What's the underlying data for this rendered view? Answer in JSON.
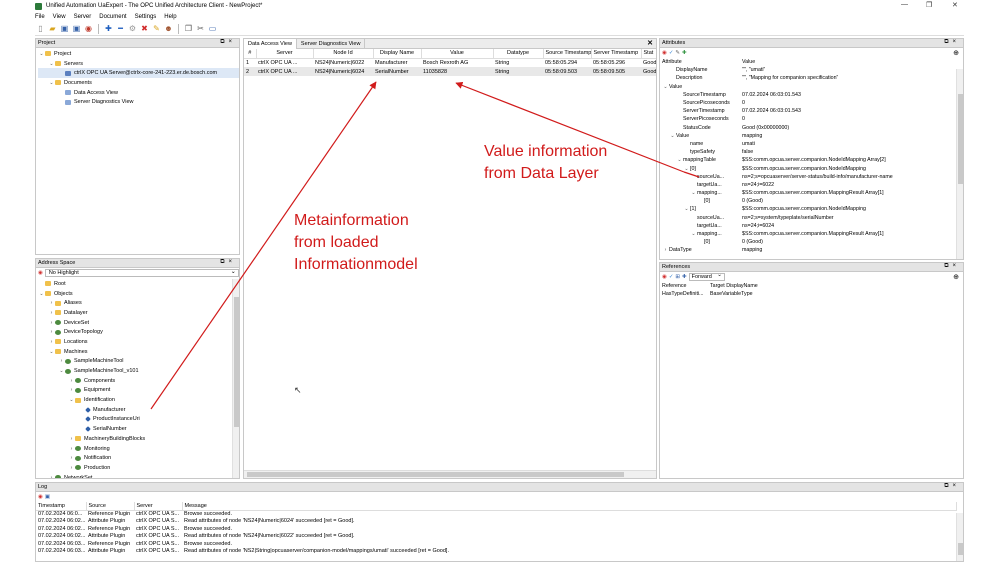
{
  "window": {
    "title": "Unified Automation UaExpert - The OPC Unified Architecture Client - NewProject*",
    "controls": [
      "—",
      "❐",
      "✕"
    ]
  },
  "menu": [
    "File",
    "View",
    "Server",
    "Document",
    "Settings",
    "Help"
  ],
  "project_panel": {
    "title": "Project",
    "items": [
      {
        "label": "Project",
        "level": 0,
        "icon": "folder-icon",
        "arrow": "v"
      },
      {
        "label": "Servers",
        "level": 1,
        "icon": "folder-icon",
        "arrow": "v"
      },
      {
        "label": "ctrlX OPC UA Server@ctrlx-core-241-223.er.de.bosch.com",
        "level": 2,
        "icon": "server-icon",
        "arrow": "",
        "selected": true
      },
      {
        "label": "Documents",
        "level": 1,
        "icon": "folder-icon",
        "arrow": "v"
      },
      {
        "label": "Data Access View",
        "level": 2,
        "icon": "document-icon",
        "arrow": ""
      },
      {
        "label": "Server Diagnostics View",
        "level": 2,
        "icon": "document-icon",
        "arrow": ""
      }
    ]
  },
  "address_panel": {
    "title": "Address Space",
    "filter": "No Highlight",
    "items": [
      {
        "label": "Root",
        "level": 0,
        "icon": "folder-icon",
        "arrow": ""
      },
      {
        "label": "Objects",
        "level": 0,
        "icon": "folder-icon",
        "arrow": "v"
      },
      {
        "label": "Aliases",
        "level": 1,
        "icon": "folder-icon",
        "arrow": ">"
      },
      {
        "label": "Datalayer",
        "level": 1,
        "icon": "folder-icon",
        "arrow": ">"
      },
      {
        "label": "DeviceSet",
        "level": 1,
        "icon": "object-icon",
        "arrow": ">"
      },
      {
        "label": "DeviceTopology",
        "level": 1,
        "icon": "object-icon",
        "arrow": ">"
      },
      {
        "label": "Locations",
        "level": 1,
        "icon": "folder-icon",
        "arrow": ">"
      },
      {
        "label": "Machines",
        "level": 1,
        "icon": "folder-icon",
        "arrow": "v"
      },
      {
        "label": "SampleMachineTool",
        "level": 2,
        "icon": "object-icon",
        "arrow": ">"
      },
      {
        "label": "SampleMachineTool_v101",
        "level": 2,
        "icon": "object-icon",
        "arrow": "v"
      },
      {
        "label": "Components",
        "level": 3,
        "icon": "object-icon",
        "arrow": ">"
      },
      {
        "label": "Equipment",
        "level": 3,
        "icon": "object-icon",
        "arrow": ">"
      },
      {
        "label": "Identification",
        "level": 3,
        "icon": "folder-icon",
        "arrow": "v"
      },
      {
        "label": "Manufacturer",
        "level": 4,
        "icon": "variable-icon",
        "arrow": ""
      },
      {
        "label": "ProductInstanceUri",
        "level": 4,
        "icon": "variable-icon",
        "arrow": ""
      },
      {
        "label": "SerialNumber",
        "level": 4,
        "icon": "variable-icon",
        "arrow": ""
      },
      {
        "label": "MachineryBuildingBlocks",
        "level": 3,
        "icon": "folder-icon",
        "arrow": ">"
      },
      {
        "label": "Monitoring",
        "level": 3,
        "icon": "object-icon",
        "arrow": ">"
      },
      {
        "label": "Notification",
        "level": 3,
        "icon": "object-icon",
        "arrow": ">"
      },
      {
        "label": "Production",
        "level": 3,
        "icon": "object-icon",
        "arrow": ">"
      },
      {
        "label": "NetworkSet",
        "level": 1,
        "icon": "object-icon",
        "arrow": ">"
      }
    ]
  },
  "data_access": {
    "tabs": [
      "Data Access View",
      "Server Diagnostics View"
    ],
    "columns": [
      "#",
      "Server",
      "Node Id",
      "Display Name",
      "Value",
      "Datatype",
      "Source Timestamp",
      "Server Timestamp",
      "Stat"
    ],
    "rows": [
      [
        "1",
        "ctrlX OPC UA ...",
        "NS24|Numeric|6022",
        "Manufacturer",
        "Bosch Rexroth AG",
        "String",
        "05:58:05.294",
        "05:58:05.296",
        "Good"
      ],
      [
        "2",
        "ctrlX OPC UA ...",
        "NS24|Numeric|6024",
        "SerialNumber",
        "11035828",
        "String",
        "05:58:09.503",
        "05:58:09.505",
        "Good"
      ]
    ]
  },
  "attributes": {
    "title": "Attributes",
    "columns": [
      "Attribute",
      "Value"
    ],
    "rows": [
      {
        "k": "DisplayName",
        "v": "\"\", \"umati\"",
        "level": 1,
        "arrow": ""
      },
      {
        "k": "Description",
        "v": "\"\", \"Mapping for companion specification\"",
        "level": 1,
        "arrow": ""
      },
      {
        "k": "Value",
        "v": "",
        "level": 0,
        "arrow": "v"
      },
      {
        "k": "SourceTimestamp",
        "v": "07.02.2024 06:03:01.543",
        "level": 2,
        "arrow": ""
      },
      {
        "k": "SourcePicoseconds",
        "v": "0",
        "level": 2,
        "arrow": ""
      },
      {
        "k": "ServerTimestamp",
        "v": "07.02.2024 06:03:01.543",
        "level": 2,
        "arrow": ""
      },
      {
        "k": "ServerPicoseconds",
        "v": "0",
        "level": 2,
        "arrow": ""
      },
      {
        "k": "StatusCode",
        "v": "Good (0x00000000)",
        "level": 2,
        "arrow": ""
      },
      {
        "k": "Value",
        "v": "mapping",
        "level": 1,
        "arrow": "v"
      },
      {
        "k": "name",
        "v": "umati",
        "level": 3,
        "arrow": ""
      },
      {
        "k": "typeSafety",
        "v": "false",
        "level": 3,
        "arrow": ""
      },
      {
        "k": "mappingTable",
        "v": "$SS:comm.opcua.server.companion.NodeIdMapping Array[2]",
        "level": 2,
        "arrow": "v"
      },
      {
        "k": "[0]",
        "v": "$SS:comm.opcua.server.companion.NodeIdMapping",
        "level": 3,
        "arrow": "v"
      },
      {
        "k": "sourceUa...",
        "v": "ns=2;s=opcuaserver/server-status/build-info/manufacturer-name",
        "level": 4,
        "arrow": ""
      },
      {
        "k": "targetUa...",
        "v": "ns=24;i=6022",
        "level": 4,
        "arrow": ""
      },
      {
        "k": "mapping...",
        "v": "$SS:comm.opcua.server.companion.MappingResult Array[1]",
        "level": 4,
        "arrow": "v"
      },
      {
        "k": "[0]",
        "v": "0 (Good)",
        "level": 5,
        "arrow": ""
      },
      {
        "k": "[1]",
        "v": "$SS:comm.opcua.server.companion.NodeIdMapping",
        "level": 3,
        "arrow": "v"
      },
      {
        "k": "sourceUa...",
        "v": "ns=2;s=system/typeplate/serialNumber",
        "level": 4,
        "arrow": ""
      },
      {
        "k": "targetUa...",
        "v": "ns=24;i=6024",
        "level": 4,
        "arrow": ""
      },
      {
        "k": "mapping...",
        "v": "$SS:comm.opcua.server.companion.MappingResult Array[1]",
        "level": 4,
        "arrow": "v"
      },
      {
        "k": "[0]",
        "v": "0 (Good)",
        "level": 5,
        "arrow": ""
      },
      {
        "k": "DataType",
        "v": "mapping",
        "level": 0,
        "arrow": ">"
      }
    ]
  },
  "references": {
    "title": "References",
    "direction": "Forward",
    "columns": [
      "Reference",
      "Target DisplayName"
    ],
    "rows": [
      [
        "HasTypeDefiniti...",
        "BaseVariableType"
      ]
    ]
  },
  "log": {
    "title": "Log",
    "columns": [
      "Timestamp",
      "Source",
      "Server",
      "Message"
    ],
    "rows": [
      [
        "07.02.2024 06:0...",
        "Reference Plugin",
        "ctrlX OPC UA S...",
        "Browse succeeded."
      ],
      [
        "07.02.2024 06:02...",
        "Attribute Plugin",
        "ctrlX OPC UA S...",
        "Read attributes of node 'NS24|Numeric|6024' succeeded [ret = Good]."
      ],
      [
        "07.02.2024 06:02...",
        "Reference Plugin",
        "ctrlX OPC UA S...",
        "Browse succeeded."
      ],
      [
        "07.02.2024 06:02...",
        "Attribute Plugin",
        "ctrlX OPC UA S...",
        "Read attributes of node 'NS24|Numeric|6022' succeeded [ret = Good]."
      ],
      [
        "07.02.2024 06:03...",
        "Reference Plugin",
        "ctrlX OPC UA S...",
        "Browse succeeded."
      ],
      [
        "07.02.2024 06:03...",
        "Attribute Plugin",
        "ctrlX OPC UA S...",
        "Read attributes of node 'NS2|String|opcuaserver/companion-model/mappings/umati' succeeded [ret = Good]."
      ]
    ]
  },
  "annotations": {
    "value_line1": "Value information",
    "value_line2": "from Data Layer",
    "meta_line1": "Metainformation",
    "meta_line2": "from loaded",
    "meta_line3": "Informationmodel",
    "color": "#d11b1b"
  }
}
